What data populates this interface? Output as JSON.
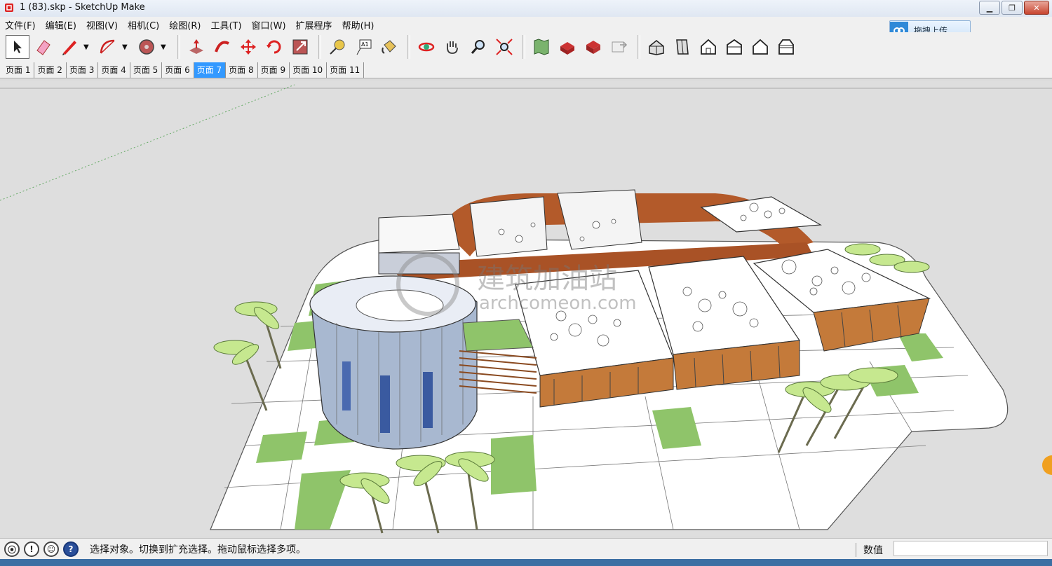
{
  "window": {
    "title": "1 (83).skp - SketchUp Make"
  },
  "menu": [
    "文件(F)",
    "编辑(E)",
    "视图(V)",
    "相机(C)",
    "绘图(R)",
    "工具(T)",
    "窗口(W)",
    "扩展程序",
    "帮助(H)"
  ],
  "upload_button": "拖拽上传",
  "scenes": [
    "页面 1",
    "页面 2",
    "页面 3",
    "页面 4",
    "页面 5",
    "页面 6",
    "页面 7",
    "页面 8",
    "页面 9",
    "页面 10",
    "页面 11"
  ],
  "active_scene": "页面 7",
  "tools": [
    "select",
    "eraser",
    "pencil",
    "arc",
    "shape",
    "push-pull",
    "follow-me",
    "move",
    "rotate",
    "scale",
    "tape-measure",
    "text",
    "paint-bucket",
    "orbit",
    "pan",
    "zoom",
    "zoom-extents",
    "components",
    "warehouse",
    "extension-warehouse",
    "share-model",
    "iso-view",
    "top-view",
    "front-view",
    "right-view",
    "back-view",
    "left-view"
  ],
  "status": {
    "message": "选择对象。切换到扩充选择。拖动鼠标选择多项。",
    "measurements_label": "数值",
    "measurements_value": ""
  },
  "watermark": {
    "text": "建筑加油站",
    "url": "archcomeon.com"
  },
  "colors": {
    "active_tab": "#3399ff",
    "titlebar": "#dfe7f2",
    "toolbar": "#f0f0f0",
    "viewport": "#dedede"
  }
}
